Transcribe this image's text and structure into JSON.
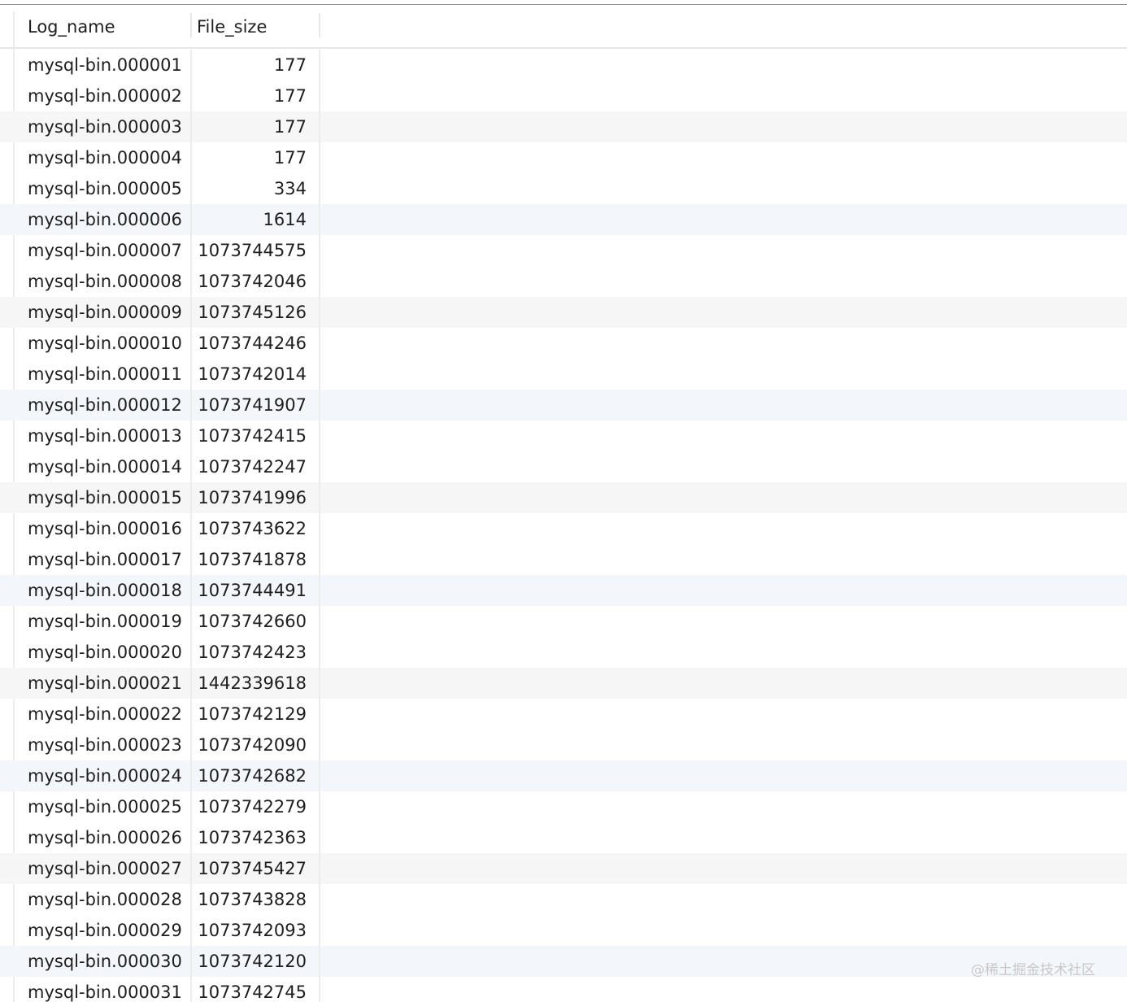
{
  "table": {
    "columns": [
      "Log_name",
      "File_size"
    ],
    "rows": [
      {
        "log_name": "mysql-bin.000001",
        "file_size": "177"
      },
      {
        "log_name": "mysql-bin.000002",
        "file_size": "177"
      },
      {
        "log_name": "mysql-bin.000003",
        "file_size": "177"
      },
      {
        "log_name": "mysql-bin.000004",
        "file_size": "177"
      },
      {
        "log_name": "mysql-bin.000005",
        "file_size": "334"
      },
      {
        "log_name": "mysql-bin.000006",
        "file_size": "1614"
      },
      {
        "log_name": "mysql-bin.000007",
        "file_size": "1073744575"
      },
      {
        "log_name": "mysql-bin.000008",
        "file_size": "1073742046"
      },
      {
        "log_name": "mysql-bin.000009",
        "file_size": "1073745126"
      },
      {
        "log_name": "mysql-bin.000010",
        "file_size": "1073744246"
      },
      {
        "log_name": "mysql-bin.000011",
        "file_size": "1073742014"
      },
      {
        "log_name": "mysql-bin.000012",
        "file_size": "1073741907"
      },
      {
        "log_name": "mysql-bin.000013",
        "file_size": "1073742415"
      },
      {
        "log_name": "mysql-bin.000014",
        "file_size": "1073742247"
      },
      {
        "log_name": "mysql-bin.000015",
        "file_size": "1073741996"
      },
      {
        "log_name": "mysql-bin.000016",
        "file_size": "1073743622"
      },
      {
        "log_name": "mysql-bin.000017",
        "file_size": "1073741878"
      },
      {
        "log_name": "mysql-bin.000018",
        "file_size": "1073744491"
      },
      {
        "log_name": "mysql-bin.000019",
        "file_size": "1073742660"
      },
      {
        "log_name": "mysql-bin.000020",
        "file_size": "1073742423"
      },
      {
        "log_name": "mysql-bin.000021",
        "file_size": "1442339618"
      },
      {
        "log_name": "mysql-bin.000022",
        "file_size": "1073742129"
      },
      {
        "log_name": "mysql-bin.000023",
        "file_size": "1073742090"
      },
      {
        "log_name": "mysql-bin.000024",
        "file_size": "1073742682"
      },
      {
        "log_name": "mysql-bin.000025",
        "file_size": "1073742279"
      },
      {
        "log_name": "mysql-bin.000026",
        "file_size": "1073742363"
      },
      {
        "log_name": "mysql-bin.000027",
        "file_size": "1073745427"
      },
      {
        "log_name": "mysql-bin.000028",
        "file_size": "1073743828"
      },
      {
        "log_name": "mysql-bin.000029",
        "file_size": "1073742093"
      },
      {
        "log_name": "mysql-bin.000030",
        "file_size": "1073742120"
      },
      {
        "log_name": "mysql-bin.000031",
        "file_size": "1073742745"
      }
    ]
  },
  "colors": {
    "stripe_gray": "#f6f6f6",
    "stripe_blue": "#f3f7fc",
    "text": "#1e1e1e"
  },
  "watermark": "@稀土掘金技术社区"
}
